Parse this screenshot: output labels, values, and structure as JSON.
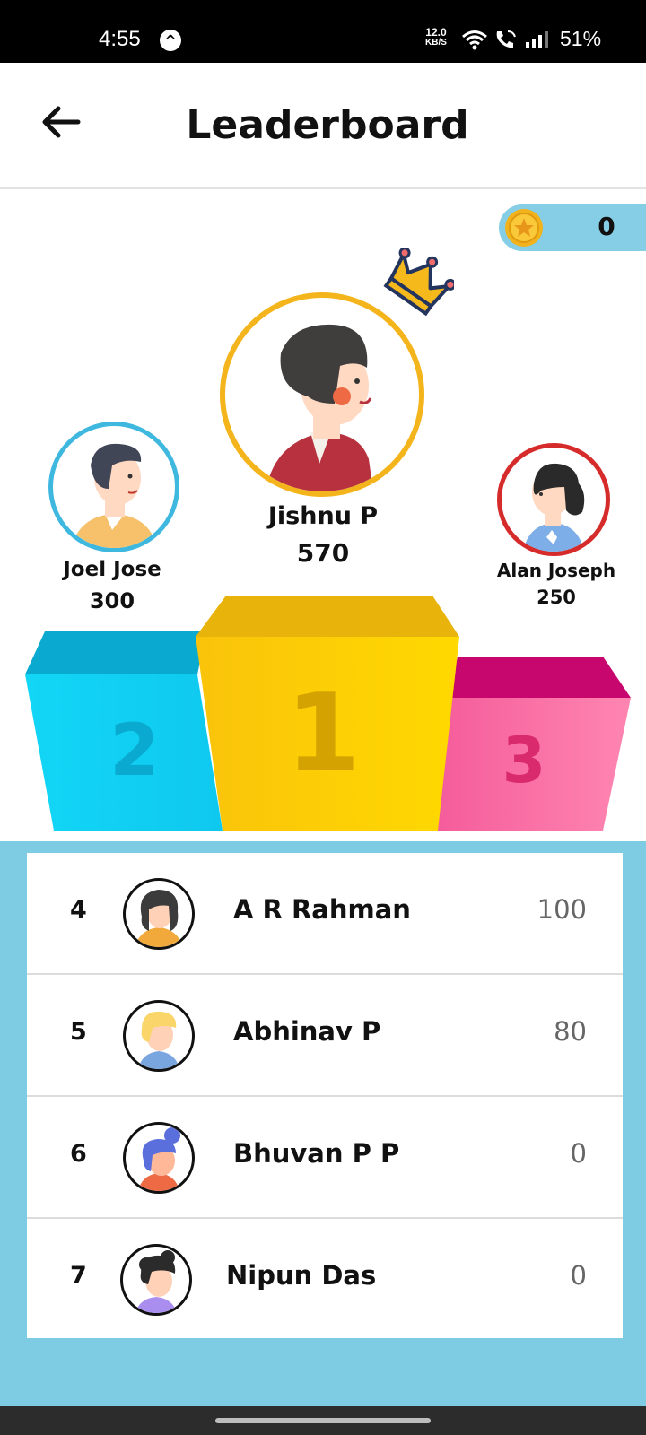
{
  "status_bar": {
    "time": "4:55",
    "app_glyph": "^",
    "net_speed_value": "12.0",
    "net_speed_unit": "KB/S",
    "battery": "51%"
  },
  "header": {
    "title": "Leaderboard",
    "back_icon": "arrow-left-icon"
  },
  "coins": {
    "value": "0",
    "icon": "star-coin-icon"
  },
  "podium": {
    "first": {
      "name": "Jishnu P",
      "score": "570",
      "rank_label": "1"
    },
    "second": {
      "name": "Joel Jose",
      "score": "300",
      "rank_label": "2"
    },
    "third": {
      "name": "Alan Joseph",
      "score": "250",
      "rank_label": "3"
    }
  },
  "list": [
    {
      "rank": "4",
      "name": "A R Rahman",
      "score": "100"
    },
    {
      "rank": "5",
      "name": "Abhinav P",
      "score": "80"
    },
    {
      "rank": "6",
      "name": "Bhuvan P P",
      "score": "0"
    },
    {
      "rank": "7",
      "name": "Nipun Das",
      "score": "0"
    }
  ],
  "colors": {
    "first_ring": "#f4b41b",
    "second_ring": "#3fb8e0",
    "third_ring": "#d62b2b",
    "list_background": "#7ecbe4"
  }
}
